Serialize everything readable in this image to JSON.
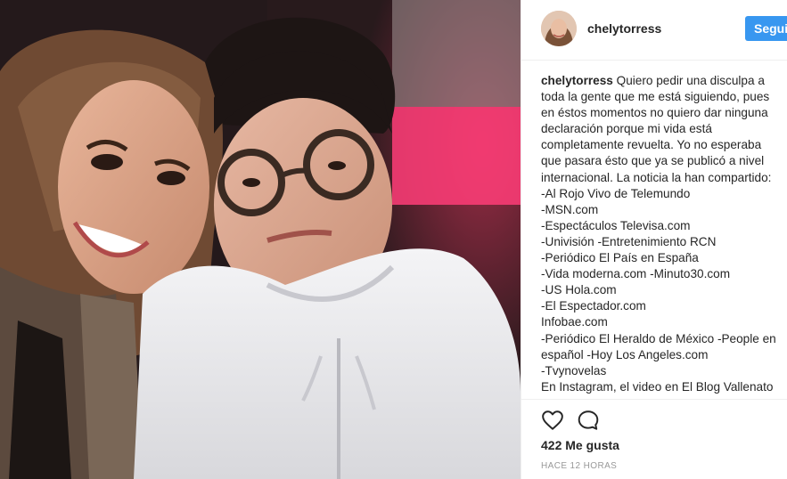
{
  "post": {
    "photo_alt": "Selfie of a woman and a young man with glasses",
    "author": "chelytorress",
    "follow_label": "Seguir",
    "caption_user": "chelytorress",
    "caption_text": " Quiero pedir una disculpa a\ntoda la gente que me está siguiendo, pues\nen éstos momentos no quiero dar ninguna\ndeclaración porque mi vida está\ncompletamente revuelta. Yo no esperaba\nque pasara ésto que ya se publicó a nivel\ninternacional. La noticia la han compartido:\n-Al Rojo Vivo de Telemundo\n-MSN.com\n-Espectáculos Televisa.com\n-Univisión -Entretenimiento RCN\n-Periódico El País en España\n-Vida moderna.com -Minuto30.com\n-US Hola.com\n-El Espectador.com\nInfobae.com\n-Periódico El Heraldo de México -People en\nespañol -Hoy Los Angeles.com\n-Tvynovelas\nEn Instagram, el video en El Blog Vallenato",
    "likes": "422 Me gusta",
    "time": "HACE 12 HORAS"
  },
  "icons": {
    "like": "heart-outline-icon",
    "comment": "comment-bubble-icon"
  },
  "colors": {
    "follow_button": "#3897f0",
    "text": "#262626",
    "muted": "#999999",
    "border": "#efefef"
  }
}
